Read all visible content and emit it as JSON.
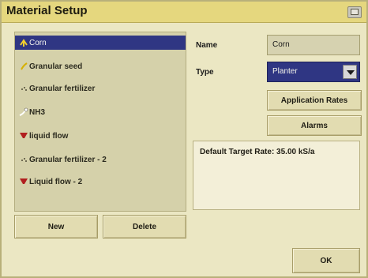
{
  "window": {
    "title": "Material Setup",
    "title_icon": "window-icon"
  },
  "materials": [
    {
      "label": "Corn",
      "icon": "corn-icon",
      "selected": true
    },
    {
      "label": "Granular seed",
      "icon": "seed-icon",
      "selected": false
    },
    {
      "label": "Granular fertilizer",
      "icon": "fertilizer-icon",
      "selected": false
    },
    {
      "label": "NH3",
      "icon": "nh3-icon",
      "selected": false
    },
    {
      "label": "liquid flow",
      "icon": "liquid-flow-icon",
      "selected": false
    },
    {
      "label": "Granular fertilizer - 2",
      "icon": "fertilizer-icon",
      "selected": false
    },
    {
      "label": "Liquid flow - 2",
      "icon": "liquid-flow-icon",
      "selected": false
    }
  ],
  "form": {
    "name_label": "Name",
    "name_value": "Corn",
    "type_label": "Type",
    "type_value": "Planter"
  },
  "buttons": {
    "application_rates": "Application Rates",
    "alarms": "Alarms",
    "new": "New",
    "delete": "Delete",
    "ok": "OK"
  },
  "details_text": "Default Target Rate: 35.00 kS/a",
  "colors": {
    "titlebar": "#e5d77e",
    "selected": "#2f3683",
    "panel": "#ebe7c3"
  }
}
